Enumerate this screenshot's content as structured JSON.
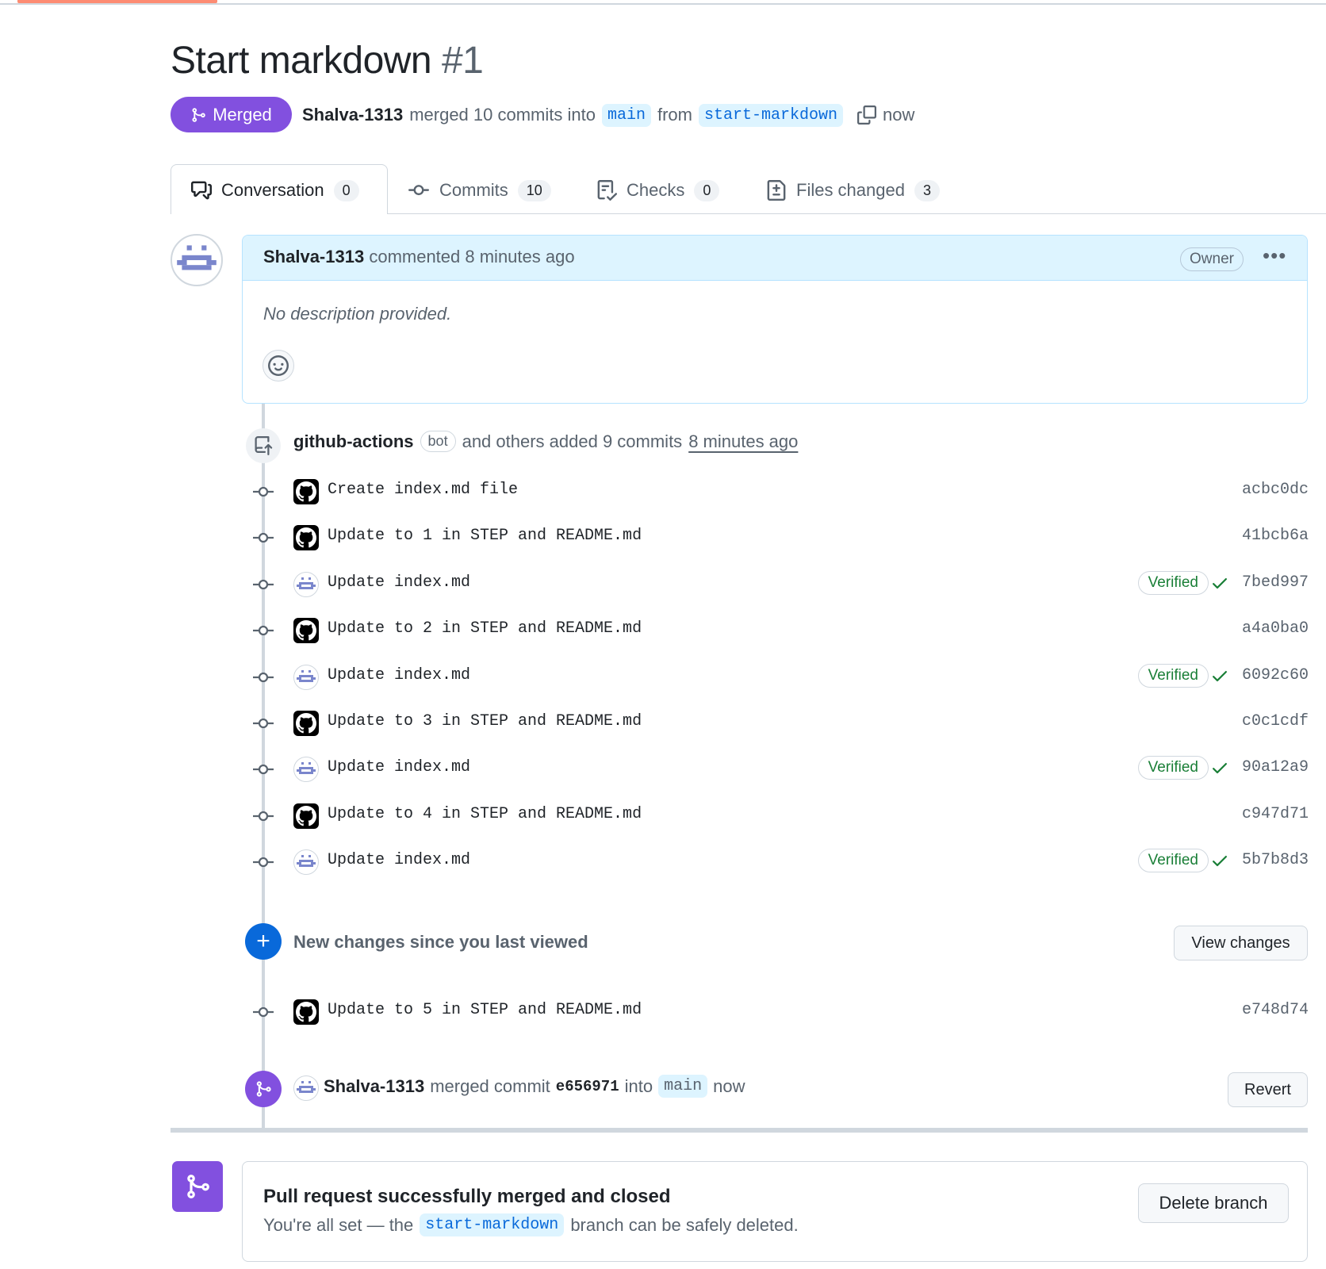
{
  "header": {
    "title": "Start markdown",
    "number": "#1",
    "state_label": "Merged",
    "author": "Shalva-1313",
    "action_text": "merged 10 commits into",
    "base_branch": "main",
    "from_text": "from",
    "head_branch": "start-markdown",
    "time": "now"
  },
  "tabs": [
    {
      "label": "Conversation",
      "count": "0",
      "icon": "comment-discussion-icon",
      "active": true
    },
    {
      "label": "Commits",
      "count": "10",
      "icon": "git-commit-icon"
    },
    {
      "label": "Checks",
      "count": "0",
      "icon": "checklist-icon"
    },
    {
      "label": "Files changed",
      "count": "3",
      "icon": "file-diff-icon"
    }
  ],
  "comment": {
    "author": "Shalva-1313",
    "action": "commented 8 minutes ago",
    "role_badge": "Owner",
    "menu_icon": "kebab-horizontal-icon",
    "body": "No description provided.",
    "reaction_icon": "smiley-icon"
  },
  "push_event": {
    "actor": "github-actions",
    "bot_label": "bot",
    "text": "and others added 9 commits",
    "time": "8 minutes ago"
  },
  "commits": [
    {
      "message": "Create index.md file",
      "sha": "acbc0dc",
      "avatar": "github",
      "verified": ""
    },
    {
      "message": "Update to 1 in STEP and README.md",
      "sha": "41bcb6a",
      "avatar": "github",
      "verified": ""
    },
    {
      "message": "Update index.md",
      "sha": "7bed997",
      "avatar": "identicon",
      "verified": "Verified"
    },
    {
      "message": "Update to 2 in STEP and README.md",
      "sha": "a4a0ba0",
      "avatar": "github",
      "verified": ""
    },
    {
      "message": "Update index.md",
      "sha": "6092c60",
      "avatar": "identicon",
      "verified": "Verified"
    },
    {
      "message": "Update to 3 in STEP and README.md",
      "sha": "c0c1cdf",
      "avatar": "github",
      "verified": ""
    },
    {
      "message": "Update index.md",
      "sha": "90a12a9",
      "avatar": "identicon",
      "verified": "Verified"
    },
    {
      "message": "Update to 4 in STEP and README.md",
      "sha": "c947d71",
      "avatar": "github",
      "verified": ""
    },
    {
      "message": "Update index.md",
      "sha": "5b7b8d3",
      "avatar": "identicon",
      "verified": "Verified"
    }
  ],
  "new_changes": {
    "label": "New changes since you last viewed",
    "button": "View changes"
  },
  "new_commits": [
    {
      "message": "Update to 5 in STEP and README.md",
      "sha": "e748d74",
      "avatar": "github",
      "verified": ""
    }
  ],
  "merge_event": {
    "actor": "Shalva-1313",
    "text": "merged commit",
    "sha": "e656971",
    "into": "into",
    "branch": "main",
    "time": "now",
    "button": "Revert"
  },
  "merge_box": {
    "title": "Pull request successfully merged and closed",
    "sub_before": "You're all set — the",
    "branch": "start-markdown",
    "sub_after": "branch can be safely deleted.",
    "button": "Delete branch"
  },
  "colors": {
    "merged_purple": "#8250df",
    "link_blue": "#0969da",
    "verified_green": "#1a7f37",
    "comment_header_bg": "#ddf4ff",
    "identicon_color": "#7a86cc"
  }
}
